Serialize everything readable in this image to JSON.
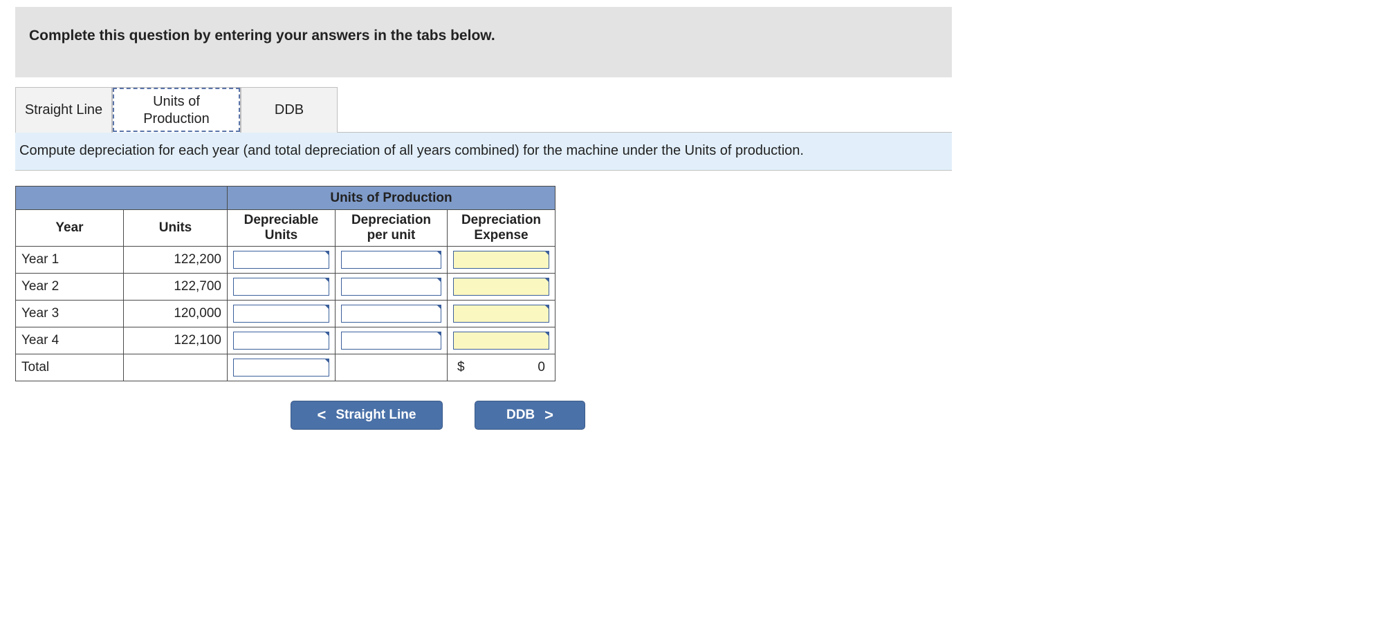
{
  "instruction": "Complete this question by entering your answers in the tabs below.",
  "tabs": {
    "straight_line": "Straight Line",
    "units_of_production": "Units of Production",
    "ddb": "DDB"
  },
  "sub_instruction": "Compute depreciation for each year (and total depreciation of all years combined) for the machine under the Units of production.",
  "table": {
    "title": "Units of Production",
    "headers": {
      "year": "Year",
      "units": "Units",
      "depreciable_units": "Depreciable Units",
      "depreciation_per_unit": "Depreciation per unit",
      "depreciation_expense": "Depreciation Expense"
    },
    "rows": [
      {
        "year": "Year 1",
        "units": "122,200"
      },
      {
        "year": "Year 2",
        "units": "122,700"
      },
      {
        "year": "Year 3",
        "units": "120,000"
      },
      {
        "year": "Year 4",
        "units": "122,100"
      }
    ],
    "total_label": "Total",
    "total_currency": "$",
    "total_value": "0"
  },
  "nav": {
    "prev_arrow": "<",
    "prev_label": "Straight Line",
    "next_label": "DDB",
    "next_arrow": ">"
  }
}
